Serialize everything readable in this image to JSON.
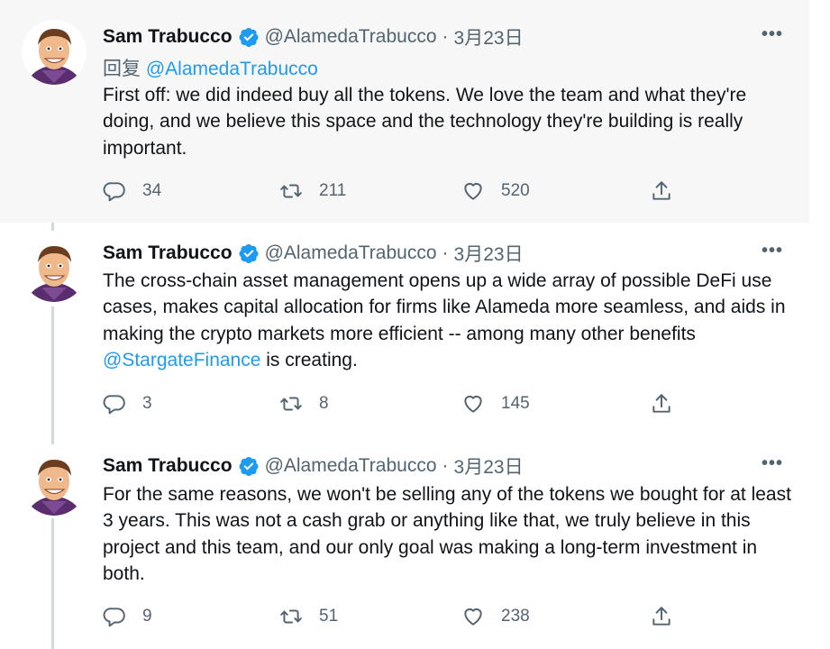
{
  "author": {
    "name": "Sam Trabucco",
    "handle": "@AlamedaTrabucco",
    "dot": "·"
  },
  "tweets": [
    {
      "date": "3月23日",
      "reply_prefix": "回复",
      "reply_to": "@AlamedaTrabucco",
      "text": "First off: we did indeed buy all the tokens. We love the team and what they're doing, and we believe this space and the technology they're building is really important.",
      "replies": "34",
      "retweets": "211",
      "likes": "520"
    },
    {
      "date": "3月23日",
      "text_before": "The cross-chain asset management opens up a wide array of possible DeFi use cases, makes capital allocation for firms like Alameda more seamless, and aids in making the crypto markets more efficient -- among many other benefits ",
      "mention": "@StargateFinance",
      "text_after": " is creating.",
      "replies": "3",
      "retweets": "8",
      "likes": "145"
    },
    {
      "date": "3月23日",
      "text": "For the same reasons, we won't be selling any of the tokens we bought for at least 3 years. This was not a cash grab or anything like that, we truly believe in this project and this team, and our only goal was making a long-term investment in both.",
      "replies": "9",
      "retweets": "51",
      "likes": "238"
    }
  ],
  "more_label": "•••",
  "colors": {
    "accent": "#1d9bf0",
    "secondary_text": "#536471",
    "thread_line": "#cfd9de",
    "highlight_bg": "#f7f7f7"
  },
  "icons": [
    "verified-badge-icon",
    "reply-icon",
    "retweet-icon",
    "like-icon",
    "share-icon",
    "more-icon",
    "avatar"
  ]
}
